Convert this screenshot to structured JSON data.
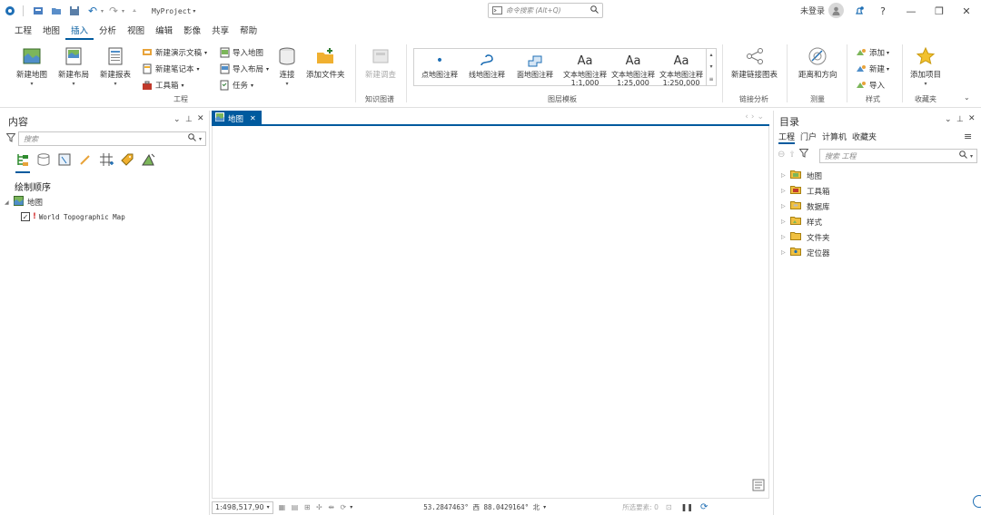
{
  "titlebar": {
    "project_name": "MyProject",
    "search_placeholder": "命令搜索 (Alt+Q)",
    "user_status": "未登录",
    "help": "?"
  },
  "menu": {
    "tabs": [
      "工程",
      "地图",
      "插入",
      "分析",
      "视图",
      "编辑",
      "影像",
      "共享",
      "帮助"
    ],
    "active_index": 2
  },
  "ribbon": {
    "project_group": {
      "new_map": "新建地图",
      "new_layout": "新建布局",
      "new_report": "新建报表",
      "new_presentation": "新建演示文稿",
      "new_notebook": "新建笔记本",
      "toolbox": "工具箱",
      "import_map": "导入地图",
      "import_layout": "导入布局",
      "task": "任务",
      "connect": "连接",
      "add_folder": "添加文件夹",
      "label": "工程"
    },
    "knowledge_group": {
      "new_investigation": "新建调查",
      "label": "知识图谱"
    },
    "layer_templates": {
      "items": [
        {
          "label": "点地图注释",
          "sub": ""
        },
        {
          "label": "线地图注释",
          "sub": ""
        },
        {
          "label": "面地图注释",
          "sub": ""
        },
        {
          "label": "文本地图注释",
          "sub": "1:1,000"
        },
        {
          "label": "文本地图注释",
          "sub": "1:25,000"
        },
        {
          "label": "文本地图注释",
          "sub": "1:250,000"
        }
      ],
      "label": "图层模板"
    },
    "link_analysis": {
      "new_link_chart": "新建链接图表",
      "label": "链接分析"
    },
    "measure": {
      "distance_direction": "距离和方向",
      "label": "测量"
    },
    "style_group": {
      "add": "添加",
      "new": "新建",
      "import": "导入",
      "label": "样式"
    },
    "favorites_group": {
      "add_item": "添加项目",
      "label": "收藏夹"
    }
  },
  "contents": {
    "title": "内容",
    "search_placeholder": "搜索",
    "draw_order": "绘制顺序",
    "map_name": "地图",
    "layer_name": "World Topographic Map"
  },
  "map_view": {
    "tab_label": "地图"
  },
  "status": {
    "scale": "1:498,517,90",
    "coordinates": "53.2847463° 西  88.0429164° 北",
    "selected_features": "所选要素: 0"
  },
  "catalog": {
    "title": "目录",
    "tabs": [
      "工程",
      "门户",
      "计算机",
      "收藏夹"
    ],
    "search_placeholder": "搜索 工程",
    "items": [
      "地图",
      "工具箱",
      "数据库",
      "样式",
      "文件夹",
      "定位器"
    ]
  }
}
